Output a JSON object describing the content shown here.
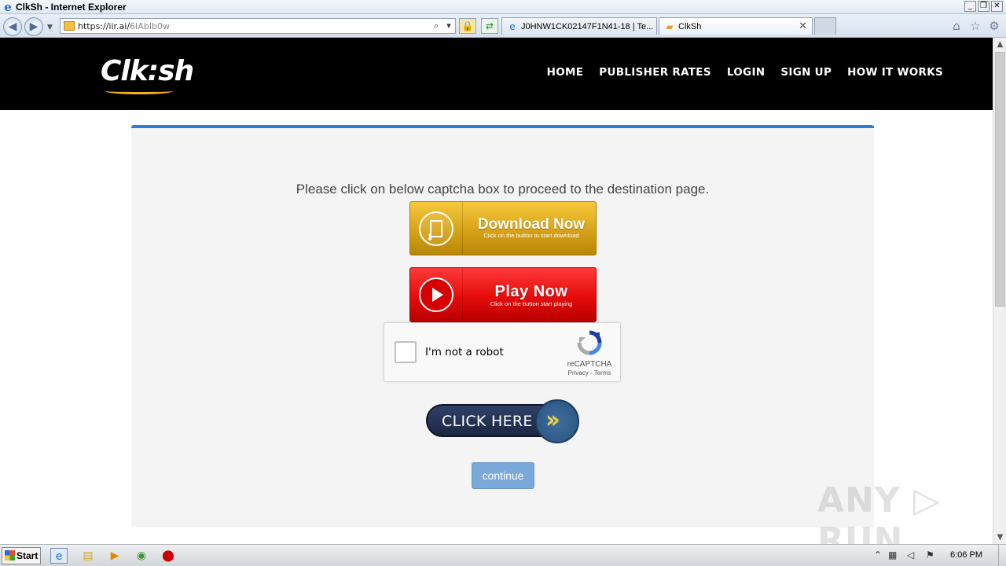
{
  "window": {
    "title": "ClkSh - Internet Explorer",
    "controls": [
      "_",
      "❐",
      "✕"
    ]
  },
  "browser": {
    "url_host": "https://iir.ai/",
    "url_path": "6IAbIb0w",
    "tabs": [
      {
        "label": "J0HNW1CK02147F1N41-18 | Te..."
      },
      {
        "label": "ClkSh",
        "close": "✕"
      }
    ]
  },
  "site": {
    "logo": "Clk:sh",
    "nav": [
      "HOME",
      "PUBLISHER RATES",
      "LOGIN",
      "SIGN UP",
      "HOW IT WORKS"
    ]
  },
  "panel": {
    "instruction": "Please click on below captcha box to proceed to the destination page.",
    "download_button": {
      "title": "Download Now",
      "subtitle": "Click on the button to start download"
    },
    "play_button": {
      "title": "Play Now",
      "subtitle": "Click on the button start playing"
    },
    "captcha": {
      "label": "I'm not a robot",
      "brand": "reCAPTCHA",
      "links": "Privacy - Terms"
    },
    "click_here": "CLICK HERE",
    "continue": "continue"
  },
  "watermark": "ANY ▷ RUN",
  "taskbar": {
    "start": "Start",
    "clock": "6:06 PM"
  },
  "colors": {
    "accent_blue": "#2f7bd5",
    "header_bg": "#000000",
    "download_gold": "#d6a219",
    "play_red": "#e50b0b",
    "continue_blue": "#7aa8d8"
  }
}
